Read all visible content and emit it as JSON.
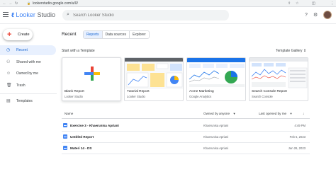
{
  "browser": {
    "url": "lookerstudio.google.com/u/0/"
  },
  "header": {
    "logo_text_1": "Looker",
    "logo_text_2": "Studio",
    "search_placeholder": "Search Looker Studio"
  },
  "sidebar": {
    "create_label": "Create",
    "items": [
      {
        "label": "Recent",
        "icon": "clock-icon"
      },
      {
        "label": "Shared with me",
        "icon": "people-icon"
      },
      {
        "label": "Owned by me",
        "icon": "person-icon"
      },
      {
        "label": "Trash",
        "icon": "trash-icon"
      },
      {
        "label": "Templates",
        "icon": "templates-icon"
      }
    ]
  },
  "main": {
    "title": "Recent",
    "tabs": [
      "Reports",
      "Data sources",
      "Explorer"
    ],
    "start_label": "Start with a Template",
    "gallery_label": "Template Gallery",
    "cards": [
      {
        "title": "Blank Report",
        "subtitle": "Looker Studio"
      },
      {
        "title": "Tutorial Report",
        "subtitle": "Looker Studio"
      },
      {
        "title": "Acme Marketing",
        "subtitle": "Google Analytics"
      },
      {
        "title": "Search Console Report",
        "subtitle": "Search Console"
      }
    ],
    "table": {
      "col_name": "Name",
      "col_owner": "Owned by anyone",
      "col_date": "Last opened by me",
      "rows": [
        {
          "name": "Exercise 3 - Khaerunisa Apriani",
          "owner": "Khaerunisa Apriani",
          "date": "4:49 PM"
        },
        {
          "name": "Untitled Report",
          "owner": "Khaerunisa Apriani",
          "date": "Feb 5, 2023"
        },
        {
          "name": "Materi 14 - DS",
          "owner": "Khaerunisa Apriani",
          "date": "Jan 26, 2023"
        }
      ]
    }
  },
  "colors": {
    "accent": "#1967d2",
    "active_bg": "#e8f0fe",
    "report_icon": "#4285f4"
  }
}
